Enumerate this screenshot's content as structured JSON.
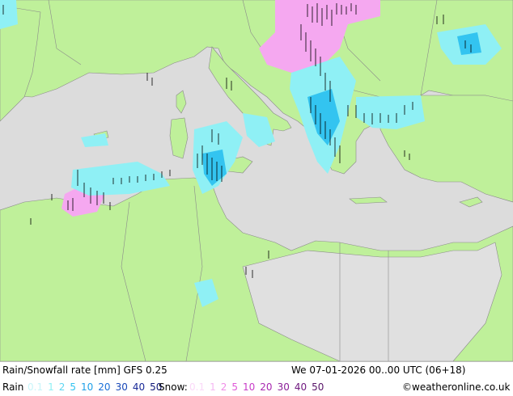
{
  "map": {
    "colors": {
      "sea": "#dcdcdc",
      "land": "#bff09a",
      "land_grey": "#e0e0e0",
      "border": "#8a8a8a",
      "rain_light": "#8ff0f5",
      "rain_mid": "#33c4f0",
      "snow_light": "#f5a8f0",
      "marker": "#000000"
    }
  },
  "footer": {
    "title": "Rain/Snowfall rate [mm] GFS 0.25",
    "datetime": "We 07-01-2026 00..00 UTC (06+18)",
    "rain_label": "Rain",
    "rain_scale": [
      {
        "text": "0.1",
        "color": "#c8f5fa"
      },
      {
        "text": "1",
        "color": "#8ff0f5"
      },
      {
        "text": "2",
        "color": "#5fd6f2"
      },
      {
        "text": "5",
        "color": "#33c4f0"
      },
      {
        "text": "10",
        "color": "#1fa0e8"
      },
      {
        "text": "20",
        "color": "#1a70d8"
      },
      {
        "text": "30",
        "color": "#1848b8"
      },
      {
        "text": "40",
        "color": "#1a2a98"
      },
      {
        "text": "50",
        "color": "#101878"
      }
    ],
    "snow_label": "Snow:",
    "snow_scale": [
      {
        "text": "0.1",
        "color": "#fbd9f9"
      },
      {
        "text": "1",
        "color": "#f5b8f3"
      },
      {
        "text": "2",
        "color": "#f08ce8"
      },
      {
        "text": "5",
        "color": "#e05ad8"
      },
      {
        "text": "10",
        "color": "#c83cc8"
      },
      {
        "text": "20",
        "color": "#a828b0"
      },
      {
        "text": "30",
        "color": "#8a1e98"
      },
      {
        "text": "40",
        "color": "#701a80"
      },
      {
        "text": "50",
        "color": "#581468"
      }
    ],
    "copyright": "©weatheronline.co.uk"
  }
}
